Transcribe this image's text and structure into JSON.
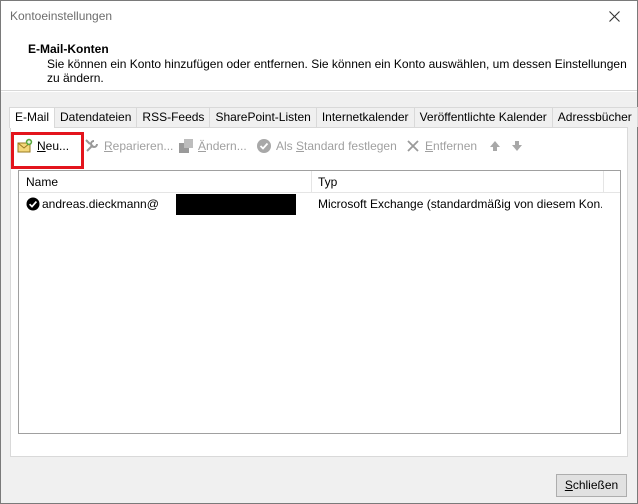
{
  "window": {
    "title": "Kontoeinstellungen"
  },
  "header": {
    "title": "E-Mail-Konten",
    "description": "Sie können ein Konto hinzufügen oder entfernen. Sie können ein Konto auswählen, um dessen Einstellungen zu ändern."
  },
  "tabs": [
    {
      "label": "E-Mail",
      "active": true
    },
    {
      "label": "Datendateien"
    },
    {
      "label": "RSS-Feeds"
    },
    {
      "label": "SharePoint-Listen"
    },
    {
      "label": "Internetkalender"
    },
    {
      "label": "Veröffentlichte Kalender"
    },
    {
      "label": "Adressbücher"
    }
  ],
  "toolbar": {
    "new_label_u": "N",
    "new_label_rest": "eu...",
    "repair_label_u": "R",
    "repair_label_rest": "eparieren...",
    "change_label_u": "Ä",
    "change_label_rest": "ndern...",
    "default_label_pre": "Als ",
    "default_label_u": "S",
    "default_label_rest": "tandard festlegen",
    "remove_label_u": "E",
    "remove_label_rest": "ntfernen"
  },
  "list": {
    "columns": [
      "Name",
      "Typ"
    ],
    "rows": [
      {
        "name": "andreas.dieckmann@",
        "type": "Microsoft Exchange (standardmäßig von diesem Kon..."
      }
    ]
  },
  "footer": {
    "close_label_u": "S",
    "close_label_rest": "chließen"
  },
  "colors": {
    "highlight": "#e3141c"
  }
}
